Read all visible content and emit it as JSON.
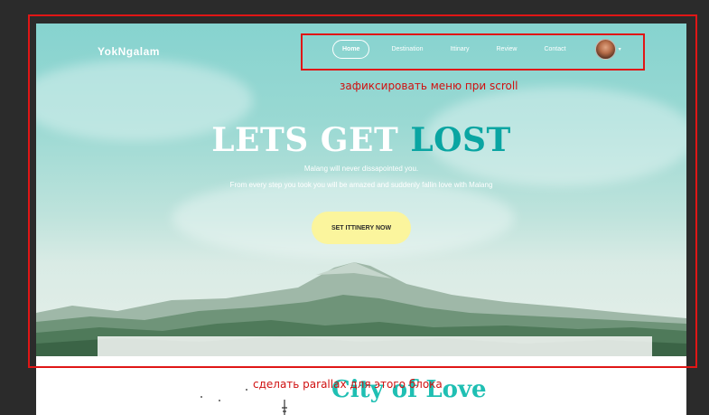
{
  "site": {
    "logo": "YokNgalam",
    "nav": {
      "items": [
        "Home",
        "Destination",
        "Ittinary",
        "Review",
        "Contact"
      ],
      "active_index": 0,
      "user_menu_caret": "▾"
    }
  },
  "hero": {
    "headline_white": "LETS GET",
    "headline_teal": "LOST",
    "sub1": "Malang will never dissapointed you.",
    "sub2": "From every step you took you will be amazed and suddenly fallin love with Malang",
    "cta_label": "SET ITTINERY NOW"
  },
  "next_section": {
    "title": "City of Love"
  },
  "annotations": {
    "menu_note": "зафиксировать меню при scroll",
    "parallax_note": "сделать parallax для этого блока"
  },
  "colors": {
    "accent_teal": "#0aa5a2",
    "cta_yellow": "#fbf59d",
    "annotation_red": "#e01616"
  }
}
